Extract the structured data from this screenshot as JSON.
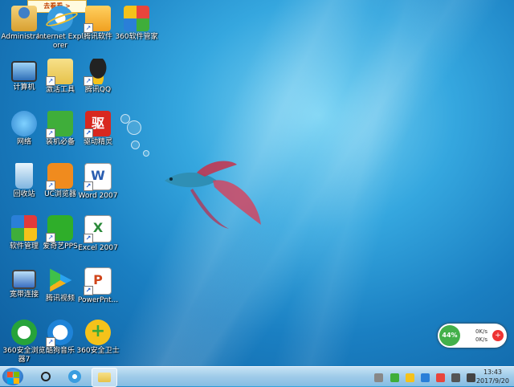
{
  "banner": {
    "text": "去看看 >"
  },
  "desktop_icons": [
    {
      "label": "Administra...",
      "icon": "user-folder-icon",
      "color": "#3f7fc8"
    },
    {
      "label": "Internet Explorer",
      "icon": "ie-icon",
      "color": "#3a9de0"
    },
    {
      "label": "腾讯软件",
      "icon": "kingsoft-icon",
      "color": "#f0a020"
    },
    {
      "label": "360软件管家",
      "icon": "360-manager-icon",
      "color": "#e8453c"
    },
    {
      "label": "计算机",
      "icon": "computer-icon",
      "color": "#2e6fb8"
    },
    {
      "label": "激活工具",
      "icon": "folder-icon",
      "color": "#e6c24a"
    },
    {
      "label": "腾讯QQ",
      "icon": "qq-icon",
      "color": "#111111"
    },
    {
      "label": "网络",
      "icon": "network-icon",
      "color": "#2f86d0"
    },
    {
      "label": "装机必备",
      "icon": "shopping-bag-icon",
      "color": "#3fae3a"
    },
    {
      "label": "驱动精灵",
      "icon": "driver-icon",
      "color": "#d8281f"
    },
    {
      "label": "回收站",
      "icon": "recycle-bin-icon",
      "color": "#7fb5e0"
    },
    {
      "label": "UC浏览器",
      "icon": "uc-browser-icon",
      "color": "#f08b1e"
    },
    {
      "label": "Word 2007",
      "icon": "word-icon",
      "color": "#2a5db0"
    },
    {
      "label": "软件管理",
      "icon": "software-manager-icon",
      "color": "#e23a3a"
    },
    {
      "label": "爱奇艺PPS",
      "icon": "iqiyi-icon",
      "color": "#2fae2a"
    },
    {
      "label": "Excel 2007",
      "icon": "excel-icon",
      "color": "#2b8a3a"
    },
    {
      "label": "宽带连接",
      "icon": "broadband-icon",
      "color": "#3a6fc0"
    },
    {
      "label": "腾讯视频",
      "icon": "tencent-video-icon",
      "color": "#2aa3f0"
    },
    {
      "label": "PowerPnt...",
      "icon": "powerpoint-icon",
      "color": "#d0451b"
    },
    {
      "label": "360安全浏览器7",
      "icon": "360-browser-icon",
      "color": "#27a33a"
    },
    {
      "label": "酷狗音乐",
      "icon": "kugou-icon",
      "color": "#1e83d8"
    },
    {
      "label": "360安全卫士",
      "icon": "360-guard-icon",
      "color": "#3aa83a"
    }
  ],
  "net_widget": {
    "percent": "44%",
    "upload": "0K/s",
    "download": "0K/s"
  },
  "taskbar": {
    "time": "13:43",
    "date": "2017/9/20"
  }
}
